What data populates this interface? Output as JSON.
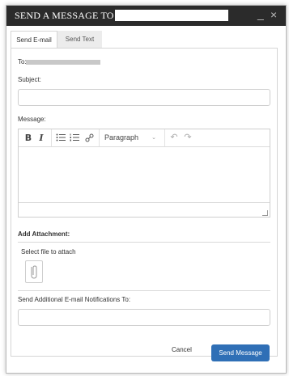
{
  "window": {
    "title": "SEND A MESSAGE TO",
    "minimize_glyph": "_",
    "close_glyph": "×"
  },
  "tabs": [
    {
      "label": "Send E-mail",
      "active": true
    },
    {
      "label": "Send Text",
      "active": false
    }
  ],
  "form": {
    "to_label": "To:",
    "subject_label": "Subject:",
    "subject_value": "",
    "message_label": "Message:",
    "editor": {
      "bold": "B",
      "italic": "I",
      "format_select": "Paragraph",
      "format_chevron": "⌄",
      "undo_glyph": "↶",
      "redo_glyph": "↷"
    },
    "attachment_heading": "Add Attachment:",
    "select_file_label": "Select file to attach",
    "notify_label": "Send Additional E-mail Notifications To:",
    "notify_value": ""
  },
  "actions": {
    "cancel_label": "Cancel",
    "send_label": "Send Message"
  },
  "colors": {
    "titlebar": "#2b2b2b",
    "primary": "#2f6fb6"
  }
}
